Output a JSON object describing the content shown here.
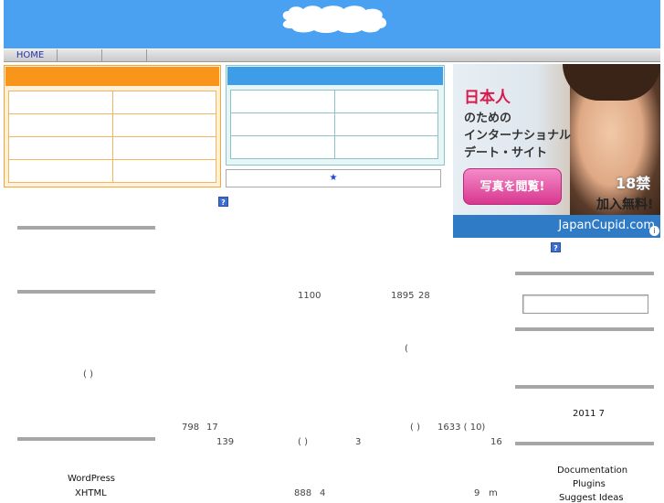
{
  "nav": {
    "items": [
      "HOME",
      "",
      ""
    ]
  },
  "star_link": "★",
  "help_icon": "?",
  "ad": {
    "line1": "日本人",
    "line2": "のための",
    "line3": "インターナショナル",
    "line4": "デート・サイト",
    "button": "写真を閲覧!",
    "age": "18禁",
    "free": "加入無料!",
    "site": "JapanCupid.com",
    "info": "i"
  },
  "main": {
    "n1": "1100",
    "n2": "1895",
    "n3": "28",
    "paren": "(",
    "n4": "798",
    "n5": "17",
    "n6": "( )",
    "n7": "1633 ( 10)",
    "n8": "139",
    "n9": "( )",
    "n10": "3",
    "n11": "16",
    "n12": "888",
    "n13": "4",
    "n14": "9",
    "n15": "m"
  },
  "left": {
    "paren": "( )",
    "wp": "WordPress",
    "xhtml": "XHTML"
  },
  "right": {
    "date": "2011 7",
    "links": [
      "Documentation",
      "Plugins",
      "Suggest Ideas"
    ]
  }
}
